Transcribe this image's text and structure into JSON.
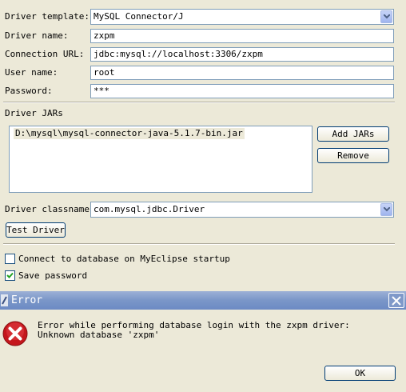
{
  "form": {
    "driver_template": {
      "label": "Driver template:",
      "value": "MySQL Connector/J"
    },
    "driver_name": {
      "label": "Driver name:",
      "value": "zxpm"
    },
    "connection_url": {
      "label": "Connection URL:",
      "value": "jdbc:mysql://localhost:3306/zxpm"
    },
    "user_name": {
      "label": "User name:",
      "value": "root"
    },
    "password": {
      "label": "Password:",
      "value": "***"
    }
  },
  "driver_jars": {
    "label": "Driver JARs",
    "items": [
      "D:\\mysql\\mysql-connector-java-5.1.7-bin.jar"
    ],
    "add_button": "Add JARs",
    "remove_button": "Remove"
  },
  "driver_classname": {
    "label": "Driver classname:",
    "value": "com.mysql.jdbc.Driver"
  },
  "test_driver_button": "Test Driver",
  "options": {
    "connect_on_startup": {
      "label": "Connect to database on MyEclipse startup",
      "checked": false
    },
    "save_password": {
      "label": "Save password",
      "checked": true
    }
  },
  "error_dialog": {
    "title": "Error",
    "message_line1": "Error while performing database login with the zxpm driver:",
    "message_line2": "Unknown database 'zxpm'",
    "ok_button": "OK",
    "icon": "error-icon"
  },
  "colors": {
    "window_bg": "#ece9d8",
    "title_bar": "#7a96c8",
    "field_border": "#7f9db9",
    "error_red": "#c4161c"
  }
}
